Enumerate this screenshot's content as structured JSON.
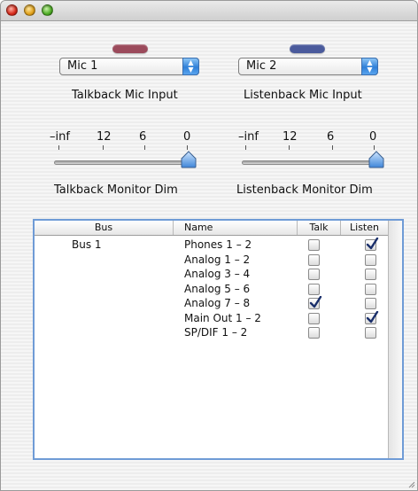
{
  "window": {
    "title": ""
  },
  "talkback": {
    "mic_select": "Mic 1",
    "caption": "Talkback Mic Input",
    "led_color": "#9b4a5b",
    "dim_caption": "Talkback Monitor Dim",
    "dim_level": 1.0
  },
  "listenback": {
    "mic_select": "Mic 2",
    "caption": "Listenback Mic Input",
    "led_color": "#4a5a9c",
    "dim_caption": "Listenback Monitor Dim",
    "dim_level": 1.0
  },
  "slider_ticks": [
    "–inf",
    "12",
    "6",
    "0"
  ],
  "table": {
    "columns": [
      "Bus",
      "Name",
      "Talk",
      "Listen"
    ],
    "bus": "Bus 1",
    "rows": [
      {
        "name": "Phones 1 – 2",
        "talk": false,
        "listen": true
      },
      {
        "name": "Analog 1 – 2",
        "talk": false,
        "listen": false
      },
      {
        "name": "Analog 3 – 4",
        "talk": false,
        "listen": false
      },
      {
        "name": "Analog 5 – 6",
        "talk": false,
        "listen": false
      },
      {
        "name": "Analog 7 – 8",
        "talk": true,
        "listen": false
      },
      {
        "name": "Main Out 1 – 2",
        "talk": false,
        "listen": true
      },
      {
        "name": "SP/DIF 1 – 2",
        "talk": false,
        "listen": false
      }
    ]
  }
}
